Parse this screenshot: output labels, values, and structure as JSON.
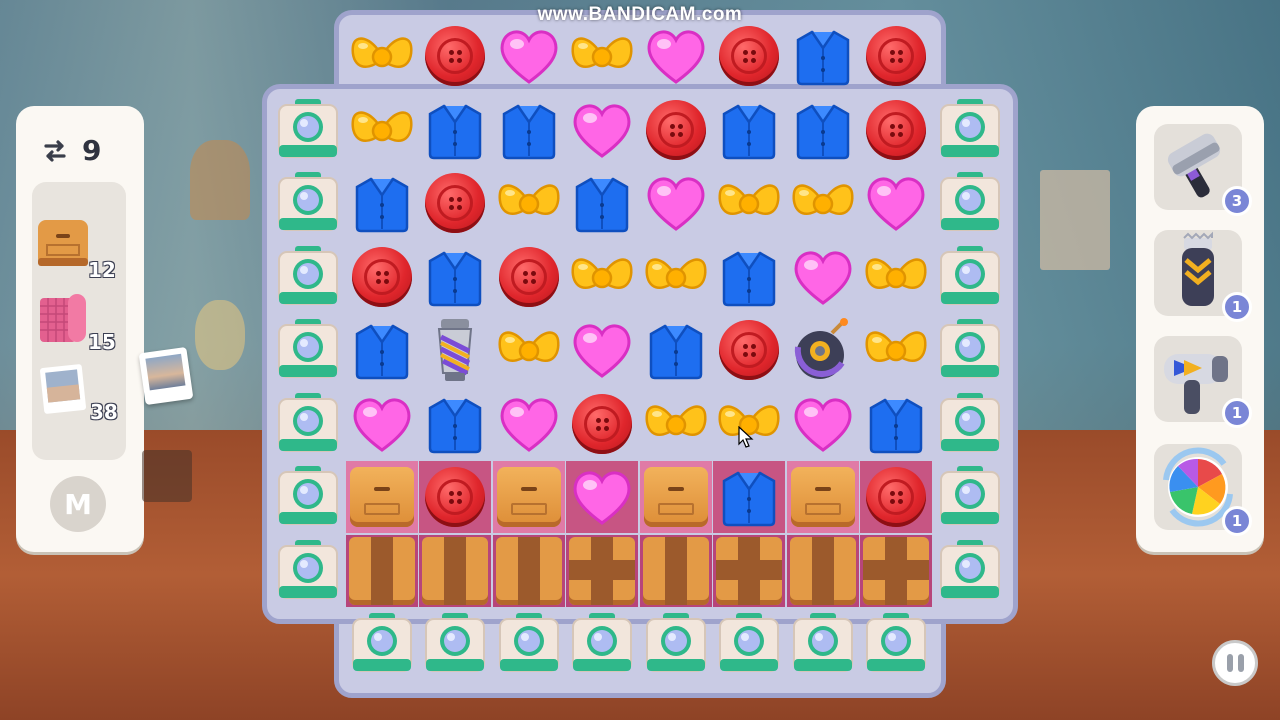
{
  "watermark": "www.BANDICAM.com",
  "moves": {
    "count": "9",
    "icon": "swap-arrows-icon"
  },
  "goals": [
    {
      "name": "crate-box",
      "count": "12"
    },
    {
      "name": "pink-fabric",
      "count": "15"
    },
    {
      "name": "photo",
      "count": "38"
    }
  ],
  "level_badge": "M",
  "boosters": [
    {
      "name": "hammer",
      "count": "3"
    },
    {
      "name": "shaver",
      "count": "1"
    },
    {
      "name": "hair-dryer",
      "count": "1"
    },
    {
      "name": "color-shuffle",
      "count": "1"
    }
  ],
  "board": {
    "columns": 10,
    "rows": 9,
    "tiles": [
      [
        "",
        "bow",
        "button",
        "heart",
        "bow",
        "heart",
        "button",
        "shirt",
        "button",
        ""
      ],
      [
        "camera",
        "bow",
        "shirt",
        "shirt",
        "heart",
        "button",
        "shirt",
        "shirt",
        "button",
        "camera"
      ],
      [
        "camera",
        "shirt",
        "button",
        "bow",
        "shirt",
        "heart",
        "bow",
        "bow",
        "heart",
        "camera"
      ],
      [
        "camera",
        "button",
        "shirt",
        "button",
        "bow",
        "bow",
        "shirt",
        "heart",
        "bow",
        "camera"
      ],
      [
        "camera",
        "shirt",
        "drill",
        "bow",
        "heart",
        "shirt",
        "button",
        "bomb",
        "bow",
        "camera"
      ],
      [
        "camera",
        "heart",
        "shirt",
        "heart",
        "button",
        "bow",
        "bow",
        "heart",
        "shirt",
        "camera"
      ],
      [
        "camera",
        "crate",
        "button",
        "crate",
        "heart",
        "crate",
        "shirt",
        "crate",
        "button",
        "camera"
      ],
      [
        "camera",
        "wrapped-v",
        "wrapped-v",
        "wrapped-v",
        "wrapped-x",
        "wrapped-v",
        "wrapped-x",
        "wrapped-v",
        "wrapped-x",
        "camera"
      ],
      [
        "",
        "camera",
        "camera",
        "camera",
        "camera",
        "camera",
        "camera",
        "camera",
        "camera",
        ""
      ]
    ]
  },
  "colors": {
    "board": "#c9cbe4",
    "highlight": "#e06a9a",
    "button": "#e0262c",
    "heart": "#ff66e6",
    "bow": "#ffc21a",
    "shirt": "#1e6ef0",
    "camera": "#2fb88a"
  }
}
